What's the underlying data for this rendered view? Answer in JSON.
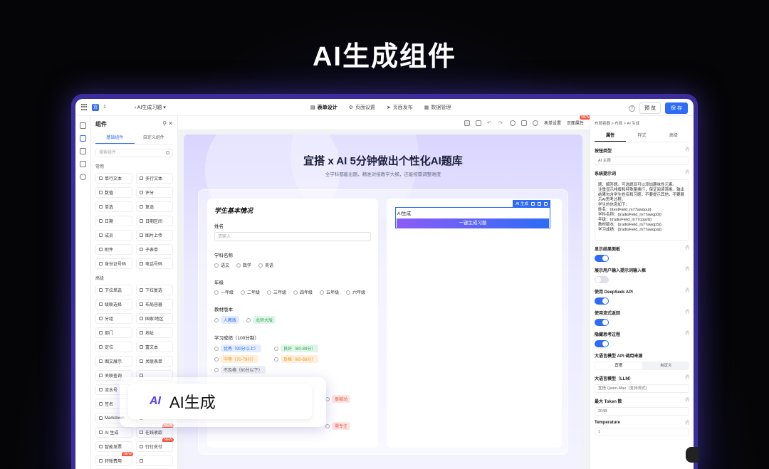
{
  "hero": {
    "title": "AI生成组件"
  },
  "topbar": {
    "app_badge": "宜",
    "app_index": "1",
    "breadcrumb": "AI生成习题",
    "tabs": [
      "表单设计",
      "页面设置",
      "页面发布",
      "数据管理"
    ],
    "preview_label": "预 览",
    "save_label": "保 存",
    "help_label": "?"
  },
  "components": {
    "title": "组件",
    "tabs": [
      "基础组件",
      "自定义组件"
    ],
    "search_placeholder": "搜索组件",
    "common_label": "常用",
    "common_items": [
      "单行文本",
      "多行文本",
      "数值",
      "评分",
      "单选",
      "复选",
      "日期",
      "日期区间",
      "成员",
      "图片上传",
      "附件",
      "子表单",
      "身份证号码",
      "电话号码"
    ],
    "advanced_label": "高级",
    "advanced_items": [
      "下拉单选",
      "下拉复选",
      "级联选择",
      "布局容器",
      "分组",
      "国家/地区",
      "部门",
      "地址",
      "定位",
      "富文本",
      "图文展示",
      "关联表单",
      "关联查询",
      "",
      "流水号",
      "",
      "签名",
      "",
      "Markdown",
      "",
      "AI 生成",
      "在线收款",
      "智能发票",
      "钉钉支付",
      "转账费用",
      ""
    ],
    "new_badge": "NEW"
  },
  "canvas": {
    "tools": [
      "表单设置",
      "页面属性"
    ],
    "new_badge": "NEW",
    "banner_title": "宜搭 x AI 5分钟做出个性化AI题库",
    "banner_sub": "全学科都能出题，精准对接教学大纲，还能按需调整难度"
  },
  "form": {
    "heading": "学生基本情况",
    "name_label": "姓名",
    "name_placeholder": "请输入",
    "subject_label": "学科名称",
    "subjects": [
      "语文",
      "数学",
      "英语"
    ],
    "grade_label": "年级",
    "grades": [
      "一年级",
      "二年级",
      "三年级",
      "四年级",
      "五年级",
      "六年级"
    ],
    "edition_label": "教材版本",
    "editions": [
      "人教版",
      "北师大版"
    ],
    "score_label": "学习成绩（100分制）",
    "scores": [
      {
        "text": "优秀（90分以上）",
        "color": "blue"
      },
      {
        "text": "良好（80-89分）",
        "color": "green"
      },
      {
        "text": "中等（70-79分）",
        "color": "orange"
      },
      {
        "text": "及格（60-69分）",
        "color": "orange"
      },
      {
        "text": "不及格（60分以下）",
        "color": "gray"
      }
    ],
    "extra_tags": [
      "很被动",
      "需专注"
    ]
  },
  "ai_widget": {
    "bar_label": "AI 生成",
    "label": "AI生成",
    "button": "一键生成习题"
  },
  "props": {
    "breadcrumb": "布局容器  >  布局  >  AI 生成",
    "tabs": [
      "属性",
      "样式",
      "高级"
    ],
    "button_type_label": "按钮类型",
    "button_type_value": "AI 主题",
    "system_prompt_label": "系统提示词",
    "system_prompt_text": "题、解答题。可选题目可以添加趣味性元素。\n注重显示排版和特殊量换行，保证阅读清晰。输出结果包含学生姓名和习题，不要提示其他，不要展示AI思考过程。\n学生的信息如下：\n姓名：{{textField_m77awqou}}\n学科名称：{{radioField_m77awqp0}}\n年级：{{radioField_m77cppvt}}\n教材版本：{{radioField_m77awqp5}}\n学习成绩：{{radioField_m77awqpa}}",
    "show_result_label": "显示结果面板",
    "show_user_input_label": "展示用户输入提示词输入框",
    "use_deepseek_label": "使用 DeepSeek API",
    "use_stream_label": "使用流式返回",
    "hide_thinking_label": "隐藏思考过程",
    "api_source_label": "大语言模型 API 调用来源",
    "api_source_options": [
      "宜搭",
      "自定义"
    ],
    "llm_label": "大语言模型（LLM）",
    "llm_value": "宜搭 Qwen-Max（支持流式）",
    "max_token_label": "最大 Token 数",
    "max_token_value": "2048",
    "temperature_label": "Temperature",
    "temperature_value": "1",
    "expr_tag": "{/}"
  },
  "float_card": {
    "icon_text": "AI",
    "label": "AI生成"
  }
}
